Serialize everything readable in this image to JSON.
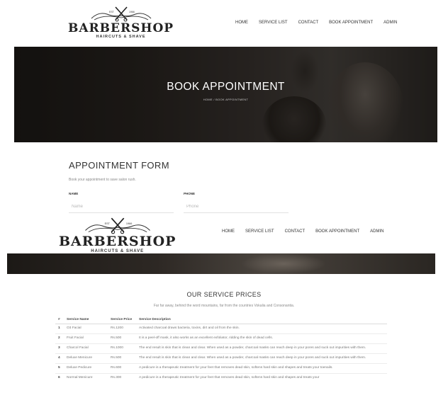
{
  "logo": {
    "top_left": "EST",
    "top_right": "1966",
    "brand": "BARBERSHOP",
    "tagline": "HAIRCUTS & SHAVE"
  },
  "nav": [
    {
      "label": "HOME"
    },
    {
      "label": "SERVICE LIST"
    },
    {
      "label": "CONTACT"
    },
    {
      "label": "BOOK APPOINTMENT"
    },
    {
      "label": "ADMIN"
    }
  ],
  "hero": {
    "title": "BOOK APPOINTMENT",
    "breadcrumb": "HOME / BOOK APPOINTMENT"
  },
  "form": {
    "title": "APPOINTMENT FORM",
    "subtitle": "Book your appointment to save salon rush.",
    "name_label": "NAME",
    "name_placeholder": "Name",
    "phone_label": "PHONE",
    "phone_placeholder": "Phone"
  },
  "prices": {
    "title": "OUR SERVICE PRICES",
    "subtitle": "Far far away, behind the word mountains, far from the countries Vokalia and Consonantia.",
    "headers": {
      "num": "#",
      "name": "Service Name",
      "price": "Service Price",
      "desc": "Service Description"
    },
    "rows": [
      {
        "num": "1",
        "name": "O3 Facial",
        "price": "Rs.1200",
        "desc": "Activated charcoal draws bacteria, toxins, dirt and oil from the skin."
      },
      {
        "num": "2",
        "name": "Fruit Facial",
        "price": "Rs.500",
        "desc": "It is a peel-off mask, it also works as an excellent exfoliator, ridding the skin of dead cells."
      },
      {
        "num": "3",
        "name": "Charcol Facial",
        "price": "Rs.1000",
        "desc": "The end result is skin that is clean and clear. When used as a powder, charcoal masks can reach deep in your pores and suck out impurities with them."
      },
      {
        "num": "4",
        "name": "Deluxe Menicure",
        "price": "Rs.500",
        "desc": "The end result is skin that is clean and clear. When used as a powder, charcoal masks can reach deep in your pores and suck out impurities with them."
      },
      {
        "num": "5",
        "name": "Deluxe Pedicure",
        "price": "Rs.600",
        "desc": "A pedicure is a therapeutic treatment for your feet that removes dead skin, softens hard skin and shapes and treats your toenails."
      },
      {
        "num": "6",
        "name": "Normal Menicure",
        "price": "Rs.300",
        "desc": "A pedicure is a therapeutic treatment for your feet that removes dead skin, softens hard skin and shapes and treats your"
      }
    ]
  }
}
